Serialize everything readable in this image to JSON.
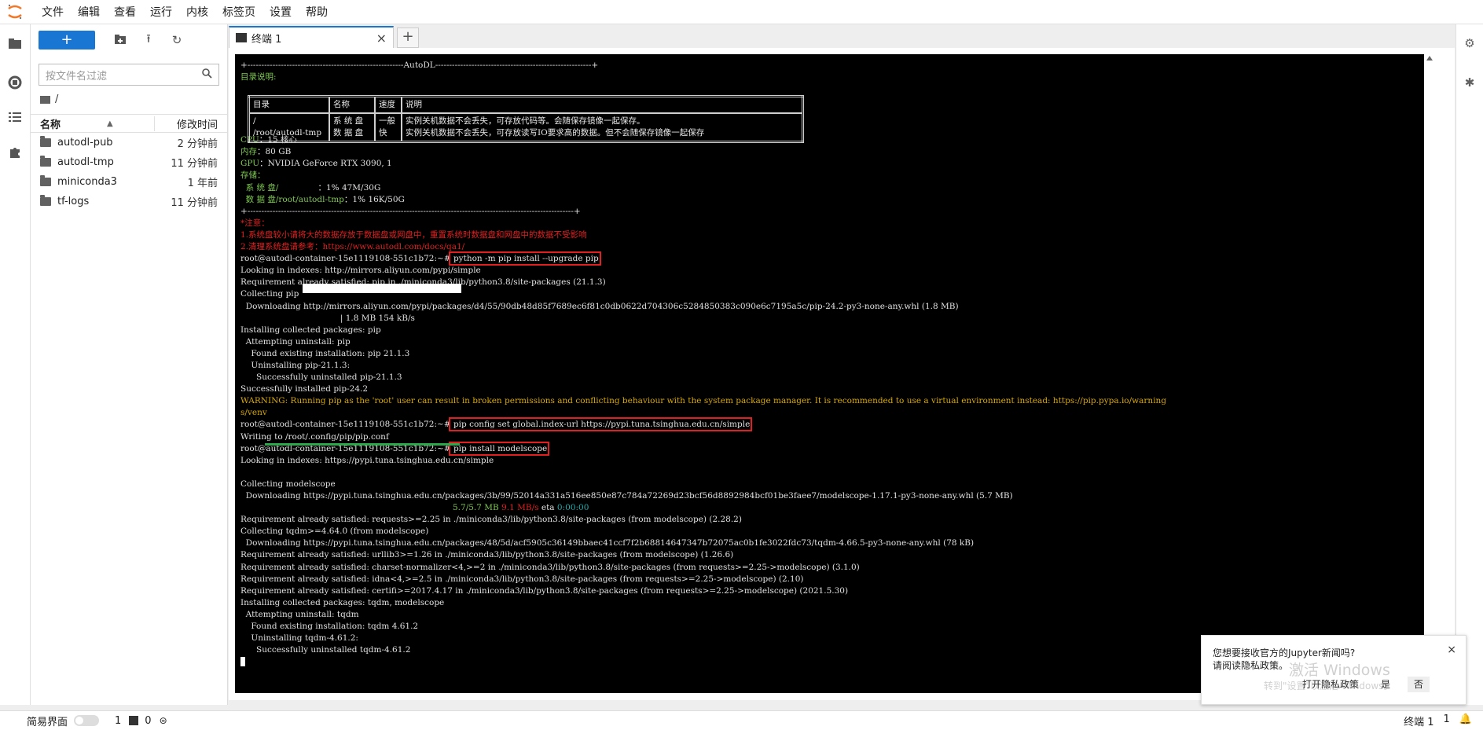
{
  "menu": [
    "文件",
    "编辑",
    "查看",
    "运行",
    "内核",
    "标签页",
    "设置",
    "帮助"
  ],
  "filebrowser": {
    "new_label": "+",
    "filter_placeholder": "按文件名过滤",
    "breadcrumb": "/",
    "col_name": "名称",
    "col_modified": "修改时间",
    "files": [
      {
        "name": "autodl-pub",
        "modified": "2 分钟前"
      },
      {
        "name": "autodl-tmp",
        "modified": "11 分钟前"
      },
      {
        "name": "miniconda3",
        "modified": "1 年前"
      },
      {
        "name": "tf-logs",
        "modified": "11 分钟前"
      }
    ]
  },
  "tab": {
    "label": "终端 1",
    "close": "×",
    "add": "+"
  },
  "terminal": {
    "banner": "+--------------------------------------------------------AutoDL--------------------------------------------------------+",
    "dir_title": "目录说明:",
    "table": {
      "headers": [
        "目录",
        "名称",
        "速度",
        "说明"
      ],
      "row_dirs": [
        "/",
        "/root/autodl-tmp"
      ],
      "row_names": [
        "系 统 盘",
        "数 据 盘"
      ],
      "row_speeds": [
        "一般",
        "快"
      ],
      "row_desc": [
        "实例关机数据不会丢失，可存放代码等。会随保存镜像一起保存。",
        "实例关机数据不会丢失，可存放读写IO要求高的数据。但不会随保存镜像一起保存"
      ]
    },
    "cpu_label": "CPU",
    "cpu_val": "：15 核心",
    "mem_label": "内存",
    "mem_val": "：80 GB",
    "gpu_label": "GPU",
    "gpu_val": "：NVIDIA GeForce RTX 3090, 1",
    "storage_label": "存储：",
    "sys_disk_label": "  系 统 盘/               ",
    "sys_disk_val": "：1% 47M/30G",
    "data_disk_label": "  数 据 盘/root/autodl-tmp",
    "data_disk_val": "：1% 16K/50G",
    "banner2": "+---------------------------------------------------------------------------------------------------------------------+",
    "note_title": "*注意：",
    "note1": "1.系统盘较小请将大的数据存放于数据盘或网盘中，重置系统时数据盘和网盘中的数据不受影响",
    "note2": "2.清理系统盘请参考：https://www.autodl.com/docs/qa1/",
    "prompt": "root@autodl-container-15e1119108-551c1b72:~#",
    "cmd1": " python -m pip install --upgrade pip",
    "l_idx1": "Looking in indexes: http://mirrors.aliyun.com/pypi/simple",
    "l_req_pip": "Requirement already satisfied: pip in ./miniconda3/lib/python3.8/site-packages (21.1.3)",
    "l_coll_pip": "Collecting pip",
    "l_dl_pip": "  Downloading http://mirrors.aliyun.com/pypi/packages/d4/55/90db48d85f7689ec6f81c0db0622d704306c5284850383c090e6c7195a5c/pip-24.2-py3-none-any.whl (1.8 MB)",
    "l_pbar1": "                                      | 1.8 MB 154 kB/s",
    "l_inst": "Installing collected packages: pip",
    "l_att": "  Attempting uninstall: pip",
    "l_found": "    Found existing installation: pip 21.1.3",
    "l_unin": "    Uninstalling pip-21.1.3:",
    "l_succ_un": "      Successfully uninstalled pip-21.1.3",
    "l_succ_in": "Successfully installed pip-24.2",
    "l_warn1": "WARNING: Running pip as the 'root' user can result in broken permissions and conflicting behaviour with the system package manager. It is recommended to use a virtual environment instead: https://pip.pypa.io/warning",
    "l_warn2": "s/venv",
    "cmd2": " pip config set global.index-url https://pypi.tuna.tsinghua.edu.cn/simple",
    "l_writing": "Writing to /root/.config/pip/pip.conf",
    "cmd3": " pip install modelscope",
    "l_idx2": "Looking in indexes: https://pypi.tuna.tsinghua.edu.cn/simple",
    "l_coll_ms": "Collecting modelscope",
    "l_dl_ms": "  Downloading https://pypi.tuna.tsinghua.edu.cn/packages/3b/99/52014a331a516ee850e87c784a72269d23bcf56d8892984bcf01be3faee7/modelscope-1.17.1-py3-none-any.whl (5.7 MB)",
    "l_pb2_size": "5.7/5.7 MB",
    "l_pb2_speed": "9.1 MB/s",
    "l_pb2_eta_label": "eta",
    "l_pb2_eta": "0:00:00",
    "l_req_requests": "Requirement already satisfied: requests>=2.25 in ./miniconda3/lib/python3.8/site-packages (from modelscope) (2.28.2)",
    "l_coll_tqdm": "Collecting tqdm>=4.64.0 (from modelscope)",
    "l_dl_tqdm": "  Downloading https://pypi.tuna.tsinghua.edu.cn/packages/48/5d/acf5905c36149bbaec41ccf7f2b68814647347b72075ac0b1fe3022fdc73/tqdm-4.66.5-py3-none-any.whl (78 kB)",
    "l_req_urllib": "Requirement already satisfied: urllib3>=1.26 in ./miniconda3/lib/python3.8/site-packages (from modelscope) (1.26.6)",
    "l_req_charset": "Requirement already satisfied: charset-normalizer<4,>=2 in ./miniconda3/lib/python3.8/site-packages (from requests>=2.25->modelscope) (3.1.0)",
    "l_req_idna": "Requirement already satisfied: idna<4,>=2.5 in ./miniconda3/lib/python3.8/site-packages (from requests>=2.25->modelscope) (2.10)",
    "l_req_certifi": "Requirement already satisfied: certifi>=2017.4.17 in ./miniconda3/lib/python3.8/site-packages (from requests>=2.25->modelscope) (2021.5.30)",
    "l_inst2": "Installing collected packages: tqdm, modelscope",
    "l_att2": "  Attempting uninstall: tqdm",
    "l_found2": "    Found existing installation: tqdm 4.61.2",
    "l_unin2": "    Uninstalling tqdm-4.61.2:",
    "l_succ_un2": "      Successfully uninstalled tqdm-4.61.2"
  },
  "notification": {
    "line1": "您想要接收官方的Jupyter新闻吗?",
    "line2": "请阅读隐私政策。",
    "open_privacy": "打开隐私政策",
    "yes": "是",
    "no": "否",
    "close": "×"
  },
  "watermark": {
    "line1": "激活 Windows",
    "line2": "转到\"设置\"以激活 Windows。"
  },
  "statusbar": {
    "simple_mode": "简易界面",
    "count1": "1",
    "count2": "0",
    "terminal_label": "终端 1",
    "right_count": "1"
  },
  "colors": {
    "accent": "#1976d2",
    "highlight": "#e02020",
    "term_green": "#7ec850",
    "term_yellow": "#d9a800",
    "term_cyan": "#1bb0b0"
  }
}
